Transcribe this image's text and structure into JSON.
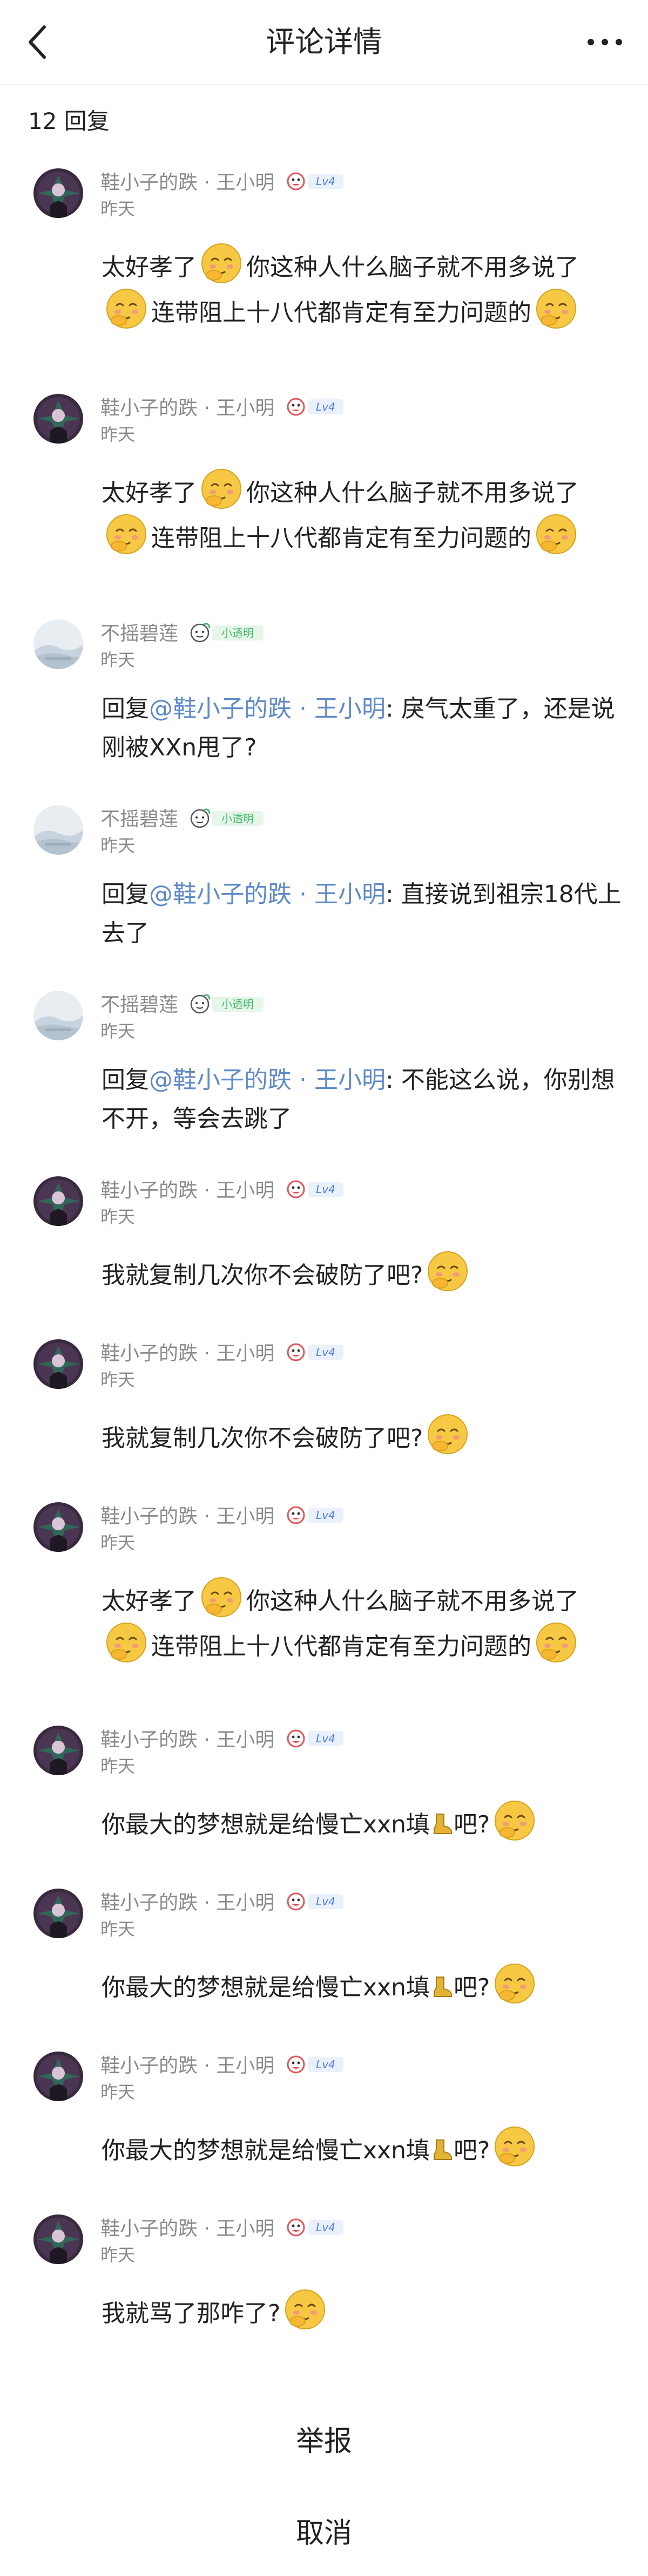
{
  "header": {
    "title": "评论详情"
  },
  "reply_count": "12 回复",
  "users": {
    "a": "鞋小子的跌 · 王小明",
    "b": "不摇碧莲"
  },
  "badges": {
    "level": "Lv4",
    "xiaotouming": "小透明"
  },
  "time_label": "昨天",
  "texts": {
    "t1_a": "太好孝了",
    "t1_b": "你这种人什么脑子就不用多说了",
    "t1_c": "连带阻上十八代都肯定有至力问题的",
    "reply_prefix": "回复",
    "mention": "@鞋小子的跌 · 王小明",
    "r1": ": 戾气太重了，还是说刚被XXn甩了?",
    "r2": ": 直接说到祖宗18代上去了",
    "r3": ": 不能这么说，你别想不开，等会去跳了",
    "copy": "我就复制几次你不会破防了吧?",
    "dream_a": "你最大的梦想就是给慢亡xxn填",
    "dream_b": "吧?",
    "last": "我就骂了那咋了?"
  },
  "sheet": {
    "report": "举报",
    "cancel": "取消"
  },
  "colors": {
    "mention": "#5e8ac7",
    "meta_gray": "#8a8a8a",
    "badge_blue": "#4f7fe0",
    "badge_green": "#44b86a"
  }
}
